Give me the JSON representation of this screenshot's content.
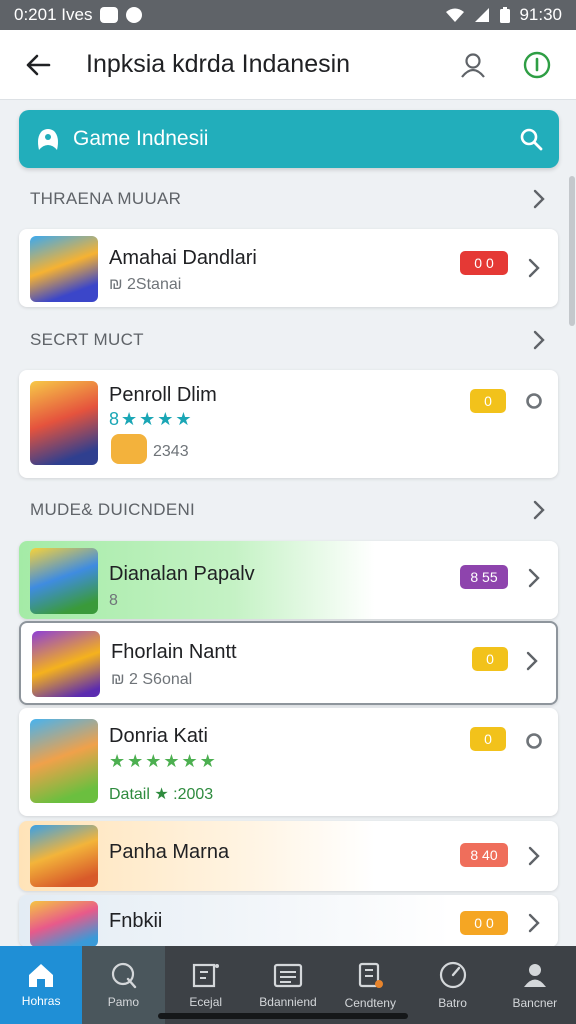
{
  "status_bar": {
    "time_left": "0:201 Ives",
    "time_right": "91:30"
  },
  "app_bar": {
    "title": "Inpksia kdrda Indanesin"
  },
  "search": {
    "label": "Game Indnesii"
  },
  "sections": [
    {
      "title": "THRAENA MUUAR"
    },
    {
      "title": "SECRT MUCT"
    },
    {
      "title": "MUDE& DUICNDENI"
    }
  ],
  "games": [
    {
      "name": "Amahai Dandlari",
      "meta": "₪ 2Stanai",
      "badge": "0 0",
      "badge_color": "#e53935"
    },
    {
      "name": "Penroll Dlim",
      "stars": "8★★★★",
      "meta": "2343",
      "badge": "0",
      "badge_color": "#f2c21b"
    },
    {
      "name": "Dianalan Papalv",
      "meta": "8",
      "badge": "8 55",
      "badge_color": "#8e44ad"
    },
    {
      "name": "Fhorlain Nantt",
      "meta": "₪ 2 S6onal",
      "badge": "0",
      "badge_color": "#f2c21b"
    },
    {
      "name": "Donria Kati",
      "stars": "★★★★★★",
      "meta": "Datail ★ :2003",
      "badge": "0",
      "badge_color": "#f2c21b"
    },
    {
      "name": "Panha Marna",
      "badge": "8 40",
      "badge_color": "#ef6e5b"
    },
    {
      "name": "Fnbkii",
      "badge": "0 0",
      "badge_color": "#f5a623"
    }
  ],
  "bottom_nav": [
    {
      "label": "Hohras",
      "icon": "home-icon"
    },
    {
      "label": "Pamo",
      "icon": "search-icon"
    },
    {
      "label": "Ecejal",
      "icon": "picture-frame-icon"
    },
    {
      "label": "Bdanniend",
      "icon": "list-icon"
    },
    {
      "label": "Cendteny",
      "icon": "ticket-icon"
    },
    {
      "label": "Batro",
      "icon": "timer-icon"
    },
    {
      "label": "Bancner",
      "icon": "profile-icon"
    }
  ]
}
